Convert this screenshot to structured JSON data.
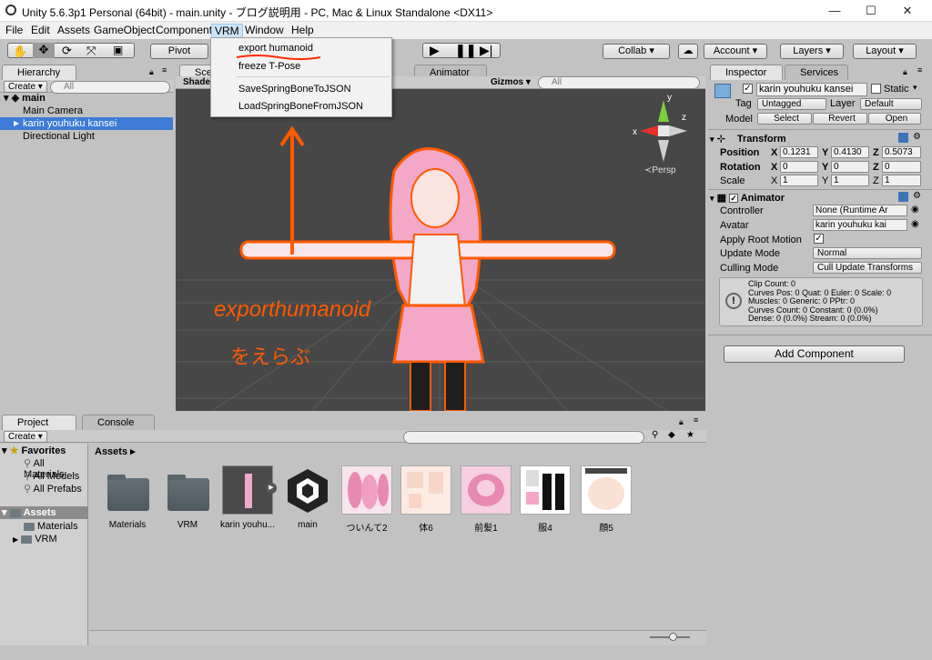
{
  "window": {
    "title": "Unity 5.6.3p1 Personal (64bit) - main.unity - ブログ説明用 - PC, Mac & Linux Standalone <DX11>",
    "minimize": "—",
    "maximize": "☐",
    "close": "✕"
  },
  "menu": {
    "items": [
      "File",
      "Edit",
      "Assets",
      "GameObject",
      "Component",
      "VRM",
      "Window",
      "Help"
    ],
    "active": "VRM"
  },
  "vrm_menu": {
    "items": [
      "export humanoid",
      "freeze T-Pose",
      "SaveSpringBoneToJSON",
      "LoadSpringBoneFromJSON"
    ]
  },
  "toolbar": {
    "pivot": "Pivot",
    "collab": "Collab ▾",
    "account": "Account ▾",
    "layers": "Layers ▾",
    "layout": "Layout ▾"
  },
  "hierarchy": {
    "tab": "Hierarchy",
    "create": "Create ▾",
    "search": "All",
    "scene": "main",
    "items": [
      "Main Camera",
      "karin youhuku kansei",
      "Directional Light"
    ],
    "selected": "karin youhuku kansei"
  },
  "scene_view": {
    "tab": "Sce",
    "shaded": "Shaded",
    "animator_tab": "Animator",
    "gizmos": "Gizmos ▾",
    "search": "All",
    "persp": "≺Persp",
    "annotation_text": "exporthumanoid",
    "annotation_sub": "をえらぶ",
    "gizmo_axes": {
      "x": "x",
      "y": "y",
      "z": "z"
    }
  },
  "inspector": {
    "tab": "Inspector",
    "services_tab": "Services",
    "object_name": "karin youhuku kansei",
    "static": "Static",
    "tag_label": "Tag",
    "tag": "Untagged",
    "layer_label": "Layer",
    "layer": "Default",
    "model_label": "Model",
    "select": "Select",
    "revert": "Revert",
    "open": "Open",
    "transform": {
      "title": "Transform",
      "position": "Position",
      "rotation": "Rotation",
      "scale": "Scale",
      "pos": {
        "x": "0.1231",
        "y": "0.4130",
        "z": "0.5073"
      },
      "rot": {
        "x": "0",
        "y": "0",
        "z": "0"
      },
      "scl": {
        "x": "1",
        "y": "1",
        "z": "1"
      }
    },
    "animator": {
      "title": "Animator",
      "controller_label": "Controller",
      "controller": "None (Runtime Ar",
      "avatar_label": "Avatar",
      "avatar": "karin youhuku kai",
      "root_motion_label": "Apply Root Motion",
      "update_label": "Update Mode",
      "update": "Normal",
      "culling_label": "Culling Mode",
      "culling": "Cull Update Transforms",
      "info": [
        "Clip Count: 0",
        "Curves Pos: 0 Quat: 0 Euler: 0 Scale: 0",
        "Muscles: 0 Generic: 0 PPtr: 0",
        "Curves Count: 0 Constant: 0 (0.0%)",
        "Dense: 0 (0.0%) Stream: 0 (0.0%)"
      ]
    },
    "add_component": "Add Component"
  },
  "project": {
    "tab": "Project",
    "console_tab": "Console",
    "create": "Create ▾",
    "favorites": "Favorites",
    "fav_items": [
      "All Materials",
      "All Models",
      "All Prefabs"
    ],
    "assets_root": "Assets",
    "asset_folders": [
      "Materials",
      "VRM"
    ],
    "breadcrumb": "Assets ▸",
    "assets": [
      "Materials",
      "VRM",
      "karin youhu...",
      "main",
      "ついんて2",
      "体6",
      "前髪1",
      "服4",
      "顔5"
    ]
  },
  "colors": {
    "selection": "#3d7bd6",
    "accent_orange": "#ff5a00",
    "scene_bg": "#474747"
  }
}
